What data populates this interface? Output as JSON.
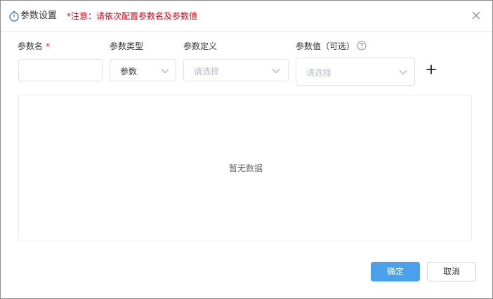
{
  "dialog": {
    "title": "参数设置",
    "notice": "*注意：请依次配置参数名及参数值",
    "icon": "timer-icon",
    "close_icon": "close-icon"
  },
  "fields": {
    "param_name": {
      "label": "参数名",
      "required_mark": "*",
      "value": ""
    },
    "param_type": {
      "label": "参数类型",
      "selected": "参数"
    },
    "param_definition": {
      "label": "参数定义",
      "placeholder": "请选择"
    },
    "param_value": {
      "label": "参数值（可选）",
      "placeholder": "请选择",
      "help_icon": "question-circle-icon"
    }
  },
  "add_icon": "plus-icon",
  "table": {
    "empty_text": "暂无数据"
  },
  "footer": {
    "confirm_label": "确定",
    "cancel_label": "取消"
  },
  "colors": {
    "notice": "#e60012",
    "primary": "#4aa0ea",
    "border": "#dcdfe6",
    "placeholder": "#b8bcc4"
  }
}
